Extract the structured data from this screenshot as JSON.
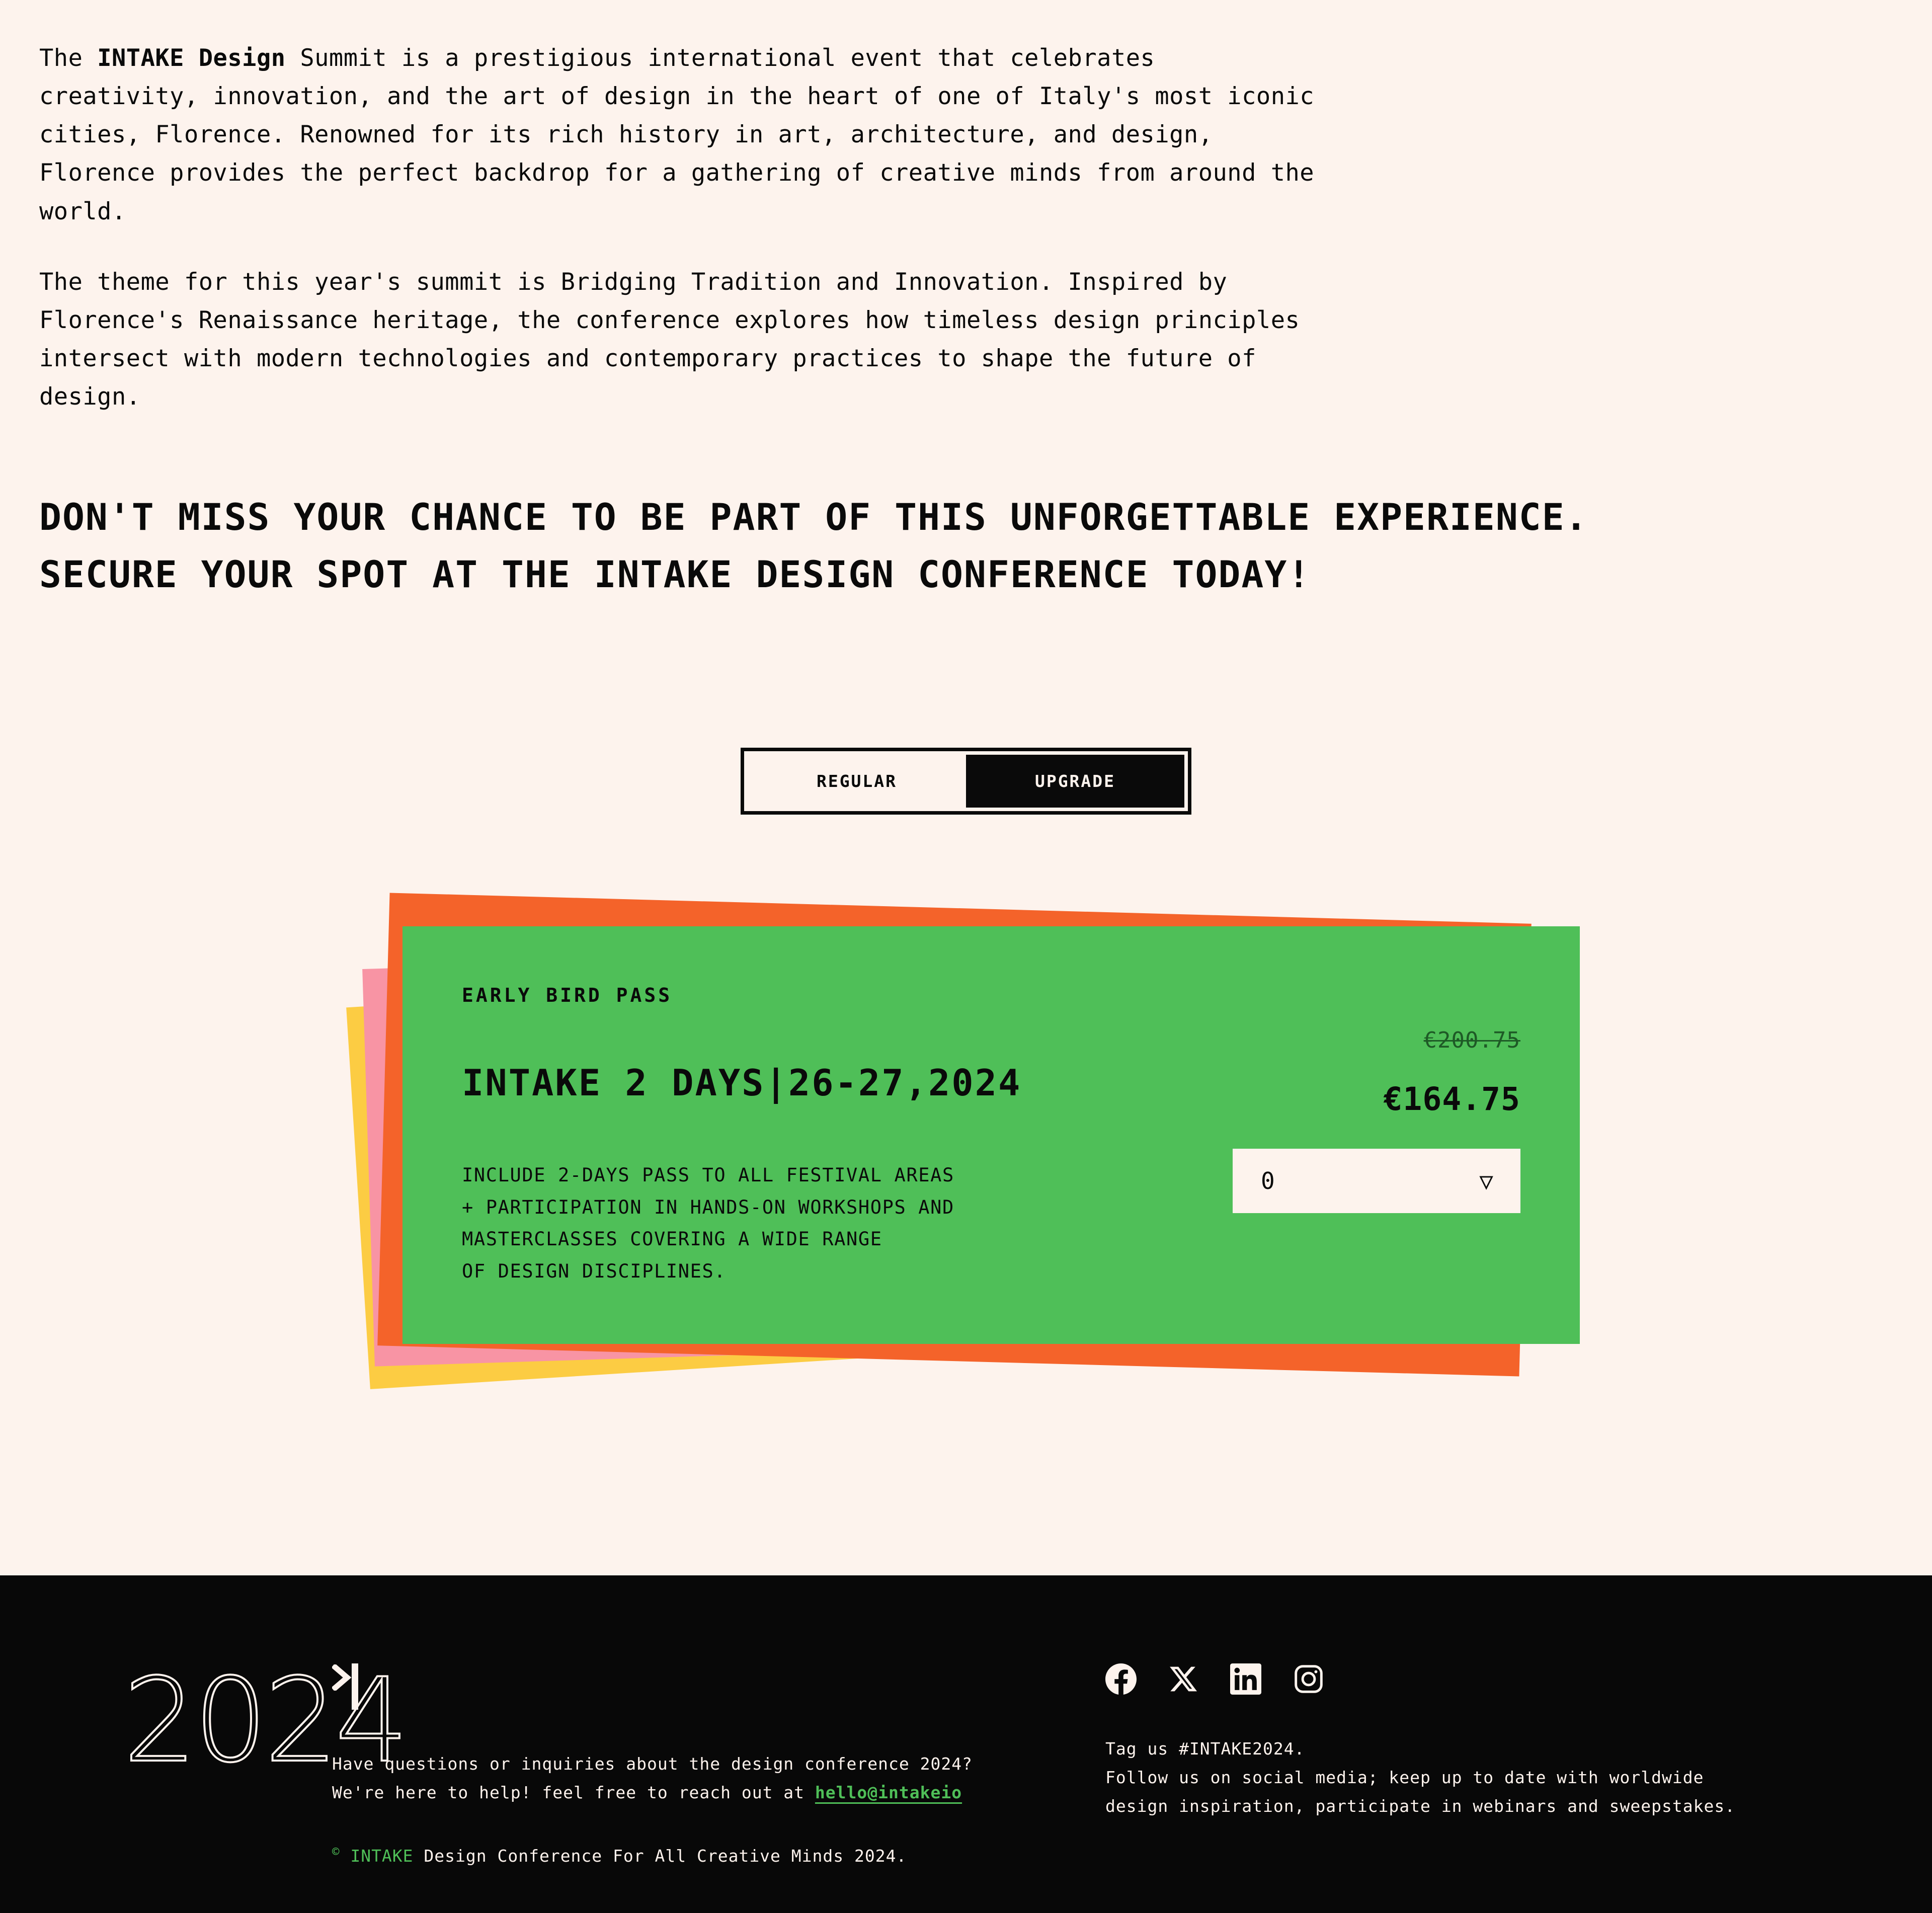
{
  "intro": {
    "paragraph1_pre": "The ",
    "paragraph1_bold": "INTAKE Design",
    "paragraph1_post": " Summit is a prestigious international event that celebrates creativity, innovation, and the art of design in the heart of one of Italy's most iconic cities, Florence. Renowned for its rich history in art, architecture, and design, Florence provides the perfect backdrop for a gathering of creative minds from around the world.",
    "paragraph2": "The theme for this year's summit is Bridging Tradition and Innovation. Inspired by Florence's Renaissance heritage, the conference explores how timeless design principles intersect with modern technologies and contemporary practices to shape the future of design."
  },
  "headline": {
    "line1": "DON'T MISS YOUR CHANCE TO BE PART OF THIS UNFORGETTABLE EXPERIENCE.",
    "line2": "SECURE YOUR SPOT AT THE INTAKE DESIGN CONFERENCE TODAY!"
  },
  "toggle": {
    "regular_label": "REGULAR",
    "upgrade_label": "UPGRADE",
    "active": "UPGRADE"
  },
  "ticket": {
    "kicker": "EARLY BIRD PASS",
    "title": "INTAKE 2 DAYS|26-27,2024",
    "description_line1": "INCLUDE 2-DAYS PASS TO ALL FESTIVAL AREAS",
    "description_line2": "+ PARTICIPATION IN HANDS-ON WORKSHOPS AND",
    "description_line3": "MASTERCLASSES COVERING A WIDE RANGE",
    "description_line4": "OF DESIGN DISCIPLINES.",
    "price_old": "€200.75",
    "price_new": "€164.75",
    "quantity_value": "0",
    "quantity_caret": "▽",
    "colors": {
      "card": "#4FBF58",
      "layer_orange": "#F4632A",
      "layer_pink": "#F894A4",
      "layer_yellow": "#FCCC43",
      "page_background": "#FDF3ED",
      "ink": "#0A0A0A"
    }
  },
  "footer": {
    "year": "2024",
    "contact_line1": "Have questions or inquiries about the design conference 2024?",
    "contact_line2_pre": "We're here to help! feel free to reach out at ",
    "contact_email": "hello@intakeio",
    "copyright_mark": "©",
    "copyright_brand": "INTAKE",
    "copyright_rest": " Design Conference For All Creative Minds 2024.",
    "social_line1": "Tag us #INTAKE2024.",
    "social_line2": "Follow us on social media; keep up to date with worldwide",
    "social_line3": "design inspiration, participate in webinars and sweepstakes.",
    "social_icons": [
      {
        "name": "facebook-icon",
        "label": "Facebook"
      },
      {
        "name": "x-twitter-icon",
        "label": "X"
      },
      {
        "name": "linkedin-icon",
        "label": "LinkedIn"
      },
      {
        "name": "instagram-icon",
        "label": "Instagram"
      }
    ],
    "accent_color": "#4FBF58",
    "background": "#080808"
  }
}
